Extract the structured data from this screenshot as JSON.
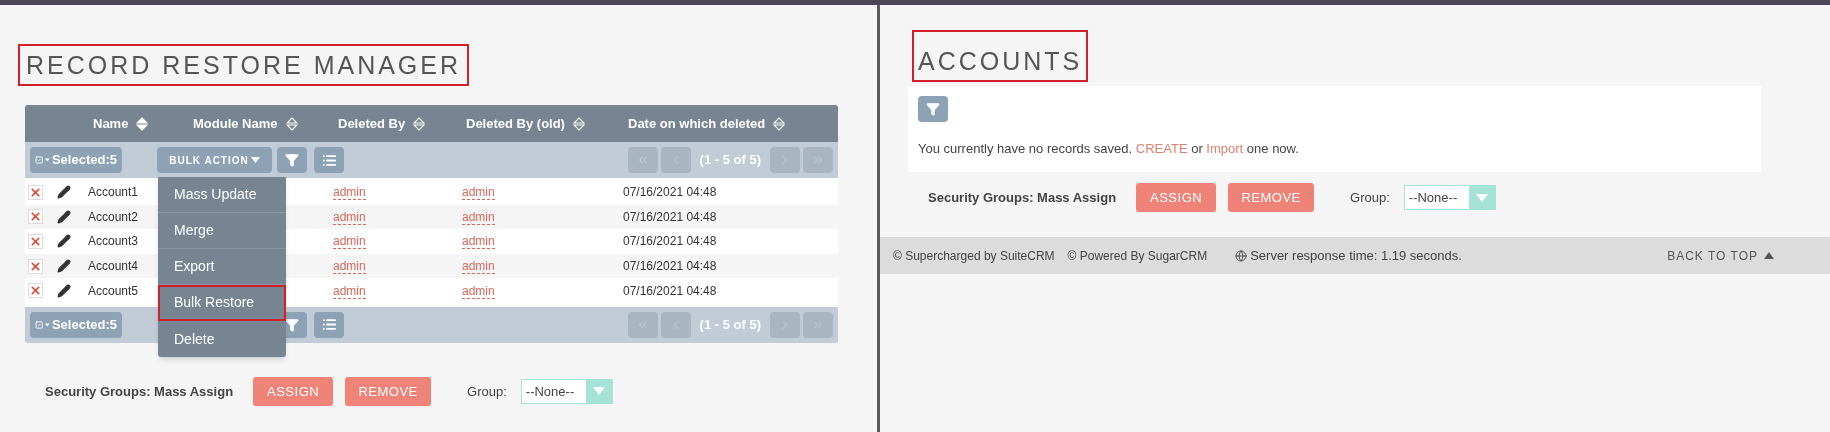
{
  "left": {
    "title": "RECORD RESTORE MANAGER",
    "table": {
      "columns": [
        {
          "label": "Name",
          "sorted": true
        },
        {
          "label": "Module Name",
          "sorted": false
        },
        {
          "label": "Deleted By",
          "sorted": false
        },
        {
          "label": "Deleted By (old)",
          "sorted": false
        },
        {
          "label": "Date on which deleted",
          "sorted": false
        }
      ],
      "toolbar": {
        "selected": "Selected:5",
        "bulk_action": "BULK ACTION",
        "pagination": "(1 - 5 of 5)"
      },
      "rows": [
        {
          "name": "Account1",
          "deleted_by": "admin",
          "deleted_by_old": "admin",
          "date": "07/16/2021 04:48"
        },
        {
          "name": "Account2",
          "deleted_by": "admin",
          "deleted_by_old": "admin",
          "date": "07/16/2021 04:48"
        },
        {
          "name": "Account3",
          "deleted_by": "admin",
          "deleted_by_old": "admin",
          "date": "07/16/2021 04:48"
        },
        {
          "name": "Account4",
          "deleted_by": "admin",
          "deleted_by_old": "admin",
          "date": "07/16/2021 04:48"
        },
        {
          "name": "Account5",
          "deleted_by": "admin",
          "deleted_by_old": "admin",
          "date": "07/16/2021 04:48"
        }
      ],
      "bottom_toolbar": {
        "selected": "Selected:5",
        "pagination": "(1 - 5 of 5)"
      }
    },
    "bulk_action_menu": [
      {
        "label": "Mass Update",
        "highlighted": false
      },
      {
        "label": "Merge",
        "highlighted": false
      },
      {
        "label": "Export",
        "highlighted": false
      },
      {
        "label": "Bulk Restore",
        "highlighted": true
      },
      {
        "label": "Delete",
        "highlighted": false
      }
    ],
    "security": {
      "label": "Security Groups: Mass Assign",
      "assign": "ASSIGN",
      "remove": "REMOVE",
      "group_label": "Group:",
      "group_value": "--None--"
    }
  },
  "right": {
    "title": "ACCOUNTS",
    "message": "You currently have no records saved.",
    "create_link": "CREATE",
    "or": "or",
    "import_link": "Import",
    "message_end": "one now.",
    "security": {
      "label": "Security Groups: Mass Assign",
      "assign": "ASSIGN",
      "remove": "REMOVE",
      "group_label": "Group:",
      "group_value": "--None--"
    },
    "footer": {
      "supercharged": "© Supercharged by SuiteCRM",
      "powered": "© Powered By SugarCRM",
      "response": "Server response time: 1.19 seconds.",
      "back_to_top": "BACK TO TOP"
    }
  }
}
